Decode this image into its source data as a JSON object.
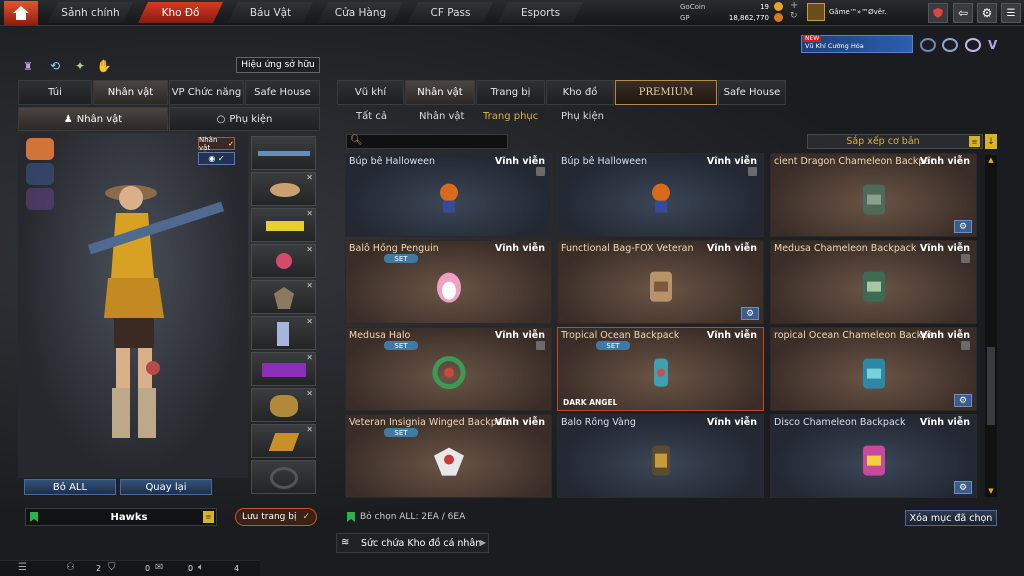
{
  "topnav": {
    "items": [
      "Sảnh chính",
      "Kho Đồ",
      "Báu Vật",
      "Cửa Hàng",
      "CF Pass",
      "Esports"
    ],
    "active": 1
  },
  "currency": {
    "gocoin_label": "GoCoin",
    "gocoin_value": "19",
    "gp_label": "GP",
    "gp_value": "18,862,770"
  },
  "user": {
    "name": "Gâme™»™Øvër."
  },
  "banner": {
    "badge": "NEW",
    "text": "Vũ Khí Cường Hóa"
  },
  "left": {
    "effect_button": "Hiệu ứng sở hữu",
    "tabs": [
      "Túi",
      "Nhân vật",
      "VP Chức năng",
      "Safe House"
    ],
    "active_tab": 1,
    "subtabs": [
      "Nhân vật",
      "Phụ kiện"
    ],
    "char_badge": "Nhân vật",
    "clear_all": "Bỏ ALL",
    "back": "Quay lại",
    "preset_name": "Hawks",
    "save_button": "Lưu trang bị"
  },
  "right": {
    "tabs": [
      "Vũ khí",
      "Nhân vật",
      "Trang bị",
      "Kho đồ",
      "PREMIUM",
      "Safe House"
    ],
    "active_tab": 1,
    "subtabs": [
      "Tất cả",
      "Nhân vật",
      "Trang phục",
      "Phụ kiện"
    ],
    "active_subtab": 2,
    "search_placeholder": "",
    "sort_label": "Sắp xếp cơ bản",
    "items": [
      {
        "name": "Búp bê Halloween",
        "duration": "Vĩnh viễn",
        "set": "",
        "tag": ""
      },
      {
        "name": "Búp bê Halloween",
        "duration": "Vĩnh viễn",
        "set": "",
        "tag": ""
      },
      {
        "name": "cient Dragon Chameleon Backpack",
        "duration": "Vĩnh viễn",
        "set": "",
        "tag": ""
      },
      {
        "name": "Balô Hồng Penguin",
        "duration": "Vĩnh viễn",
        "set": "SET",
        "tag": ""
      },
      {
        "name": "Functional Bag-FOX Veteran",
        "duration": "Vĩnh viễn",
        "set": "",
        "tag": ""
      },
      {
        "name": "Medusa Chameleon Backpack",
        "duration": "Vĩnh viễn",
        "set": "",
        "tag": ""
      },
      {
        "name": "Medusa Halo",
        "duration": "Vĩnh viễn",
        "set": "SET",
        "tag": ""
      },
      {
        "name": "Tropical Ocean Backpack",
        "duration": "Vĩnh viễn",
        "set": "SET",
        "tag": "DARK ANGEL"
      },
      {
        "name": "ropical Ocean Chameleon Backpack",
        "duration": "Vĩnh viễn",
        "set": "",
        "tag": ""
      },
      {
        "name": "Veteran Insignia Winged Backpack",
        "duration": "Vĩnh viễn",
        "set": "SET",
        "tag": ""
      },
      {
        "name": "Balo Rồng Vàng",
        "duration": "Vĩnh viễn",
        "set": "",
        "tag": ""
      },
      {
        "name": "Disco Chameleon Backpack",
        "duration": "Vĩnh viễn",
        "set": "",
        "tag": ""
      }
    ],
    "select_info": "Bỏ chọn ALL: 2EA / 6EA",
    "delete_selected": "Xóa mục đã chọn",
    "storage_label": "Sức chứa Kho đồ cá nhân"
  },
  "bottombar": {
    "friends": "2",
    "messages": "0",
    "voice": "0",
    "volume": "4"
  },
  "colors": {
    "accent": "#c8321c",
    "panel": "#18191b",
    "set_badge": "#3f7aa5",
    "gear": "#3b5d8c"
  }
}
